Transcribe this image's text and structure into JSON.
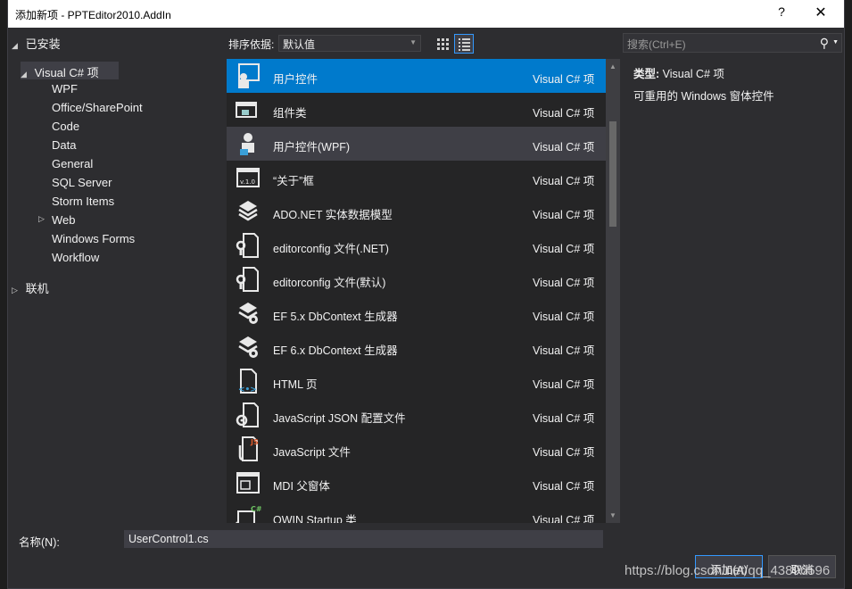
{
  "window": {
    "title": "添加新项 - PPTEditor2010.AddIn",
    "help": "?",
    "close": "✕"
  },
  "tree": {
    "installed": "已安装",
    "root": "Visual C# 项",
    "children": [
      "WPF",
      "Office/SharePoint",
      "Code",
      "Data",
      "General",
      "SQL Server",
      "Storm Items",
      "Web",
      "Windows Forms",
      "Workflow"
    ],
    "online": "联机"
  },
  "toolbar": {
    "sort_label": "排序依据:",
    "sort_value": "默认值"
  },
  "search": {
    "placeholder": "搜索(Ctrl+E)"
  },
  "templates": [
    {
      "name": "用户控件",
      "lang": "Visual C# 项",
      "icon": "user-control-icon",
      "state": "selected"
    },
    {
      "name": "组件类",
      "lang": "Visual C# 项",
      "icon": "component-class-icon",
      "state": ""
    },
    {
      "name": "用户控件(WPF)",
      "lang": "Visual C# 项",
      "icon": "wpf-user-control-icon",
      "state": "hover"
    },
    {
      "name": "“关于”框",
      "lang": "Visual C# 项",
      "icon": "about-box-icon",
      "state": ""
    },
    {
      "name": "ADO.NET 实体数据模型",
      "lang": "Visual C# 项",
      "icon": "entity-model-icon",
      "state": ""
    },
    {
      "name": "editorconfig 文件(.NET)",
      "lang": "Visual C# 项",
      "icon": "editorconfig-icon",
      "state": ""
    },
    {
      "name": "editorconfig 文件(默认)",
      "lang": "Visual C# 项",
      "icon": "editorconfig-icon",
      "state": ""
    },
    {
      "name": "EF 5.x DbContext 生成器",
      "lang": "Visual C# 项",
      "icon": "ef-generator-icon",
      "state": ""
    },
    {
      "name": "EF 6.x DbContext 生成器",
      "lang": "Visual C# 项",
      "icon": "ef-generator-icon",
      "state": ""
    },
    {
      "name": "HTML 页",
      "lang": "Visual C# 项",
      "icon": "html-page-icon",
      "state": ""
    },
    {
      "name": "JavaScript JSON 配置文件",
      "lang": "Visual C# 项",
      "icon": "json-config-icon",
      "state": ""
    },
    {
      "name": "JavaScript 文件",
      "lang": "Visual C# 项",
      "icon": "javascript-file-icon",
      "state": ""
    },
    {
      "name": "MDI 父窗体",
      "lang": "Visual C# 项",
      "icon": "mdi-form-icon",
      "state": ""
    },
    {
      "name": "OWIN Startup 类",
      "lang": "Visual C# 项",
      "icon": "owin-startup-icon",
      "state": ""
    }
  ],
  "details": {
    "type_label": "类型:",
    "type_value": "Visual C# 项",
    "description": "可重用的 Windows 窗体控件"
  },
  "footer": {
    "name_label": "名称(N):",
    "name_value": "UserControl1.cs",
    "add_label": "添加(A)",
    "cancel_label": "取消"
  },
  "watermark": "https://blog.csdn.net/qq_43896596",
  "colors": {
    "accent": "#007acc",
    "background": "#2d2d30",
    "list_background": "#252526"
  }
}
